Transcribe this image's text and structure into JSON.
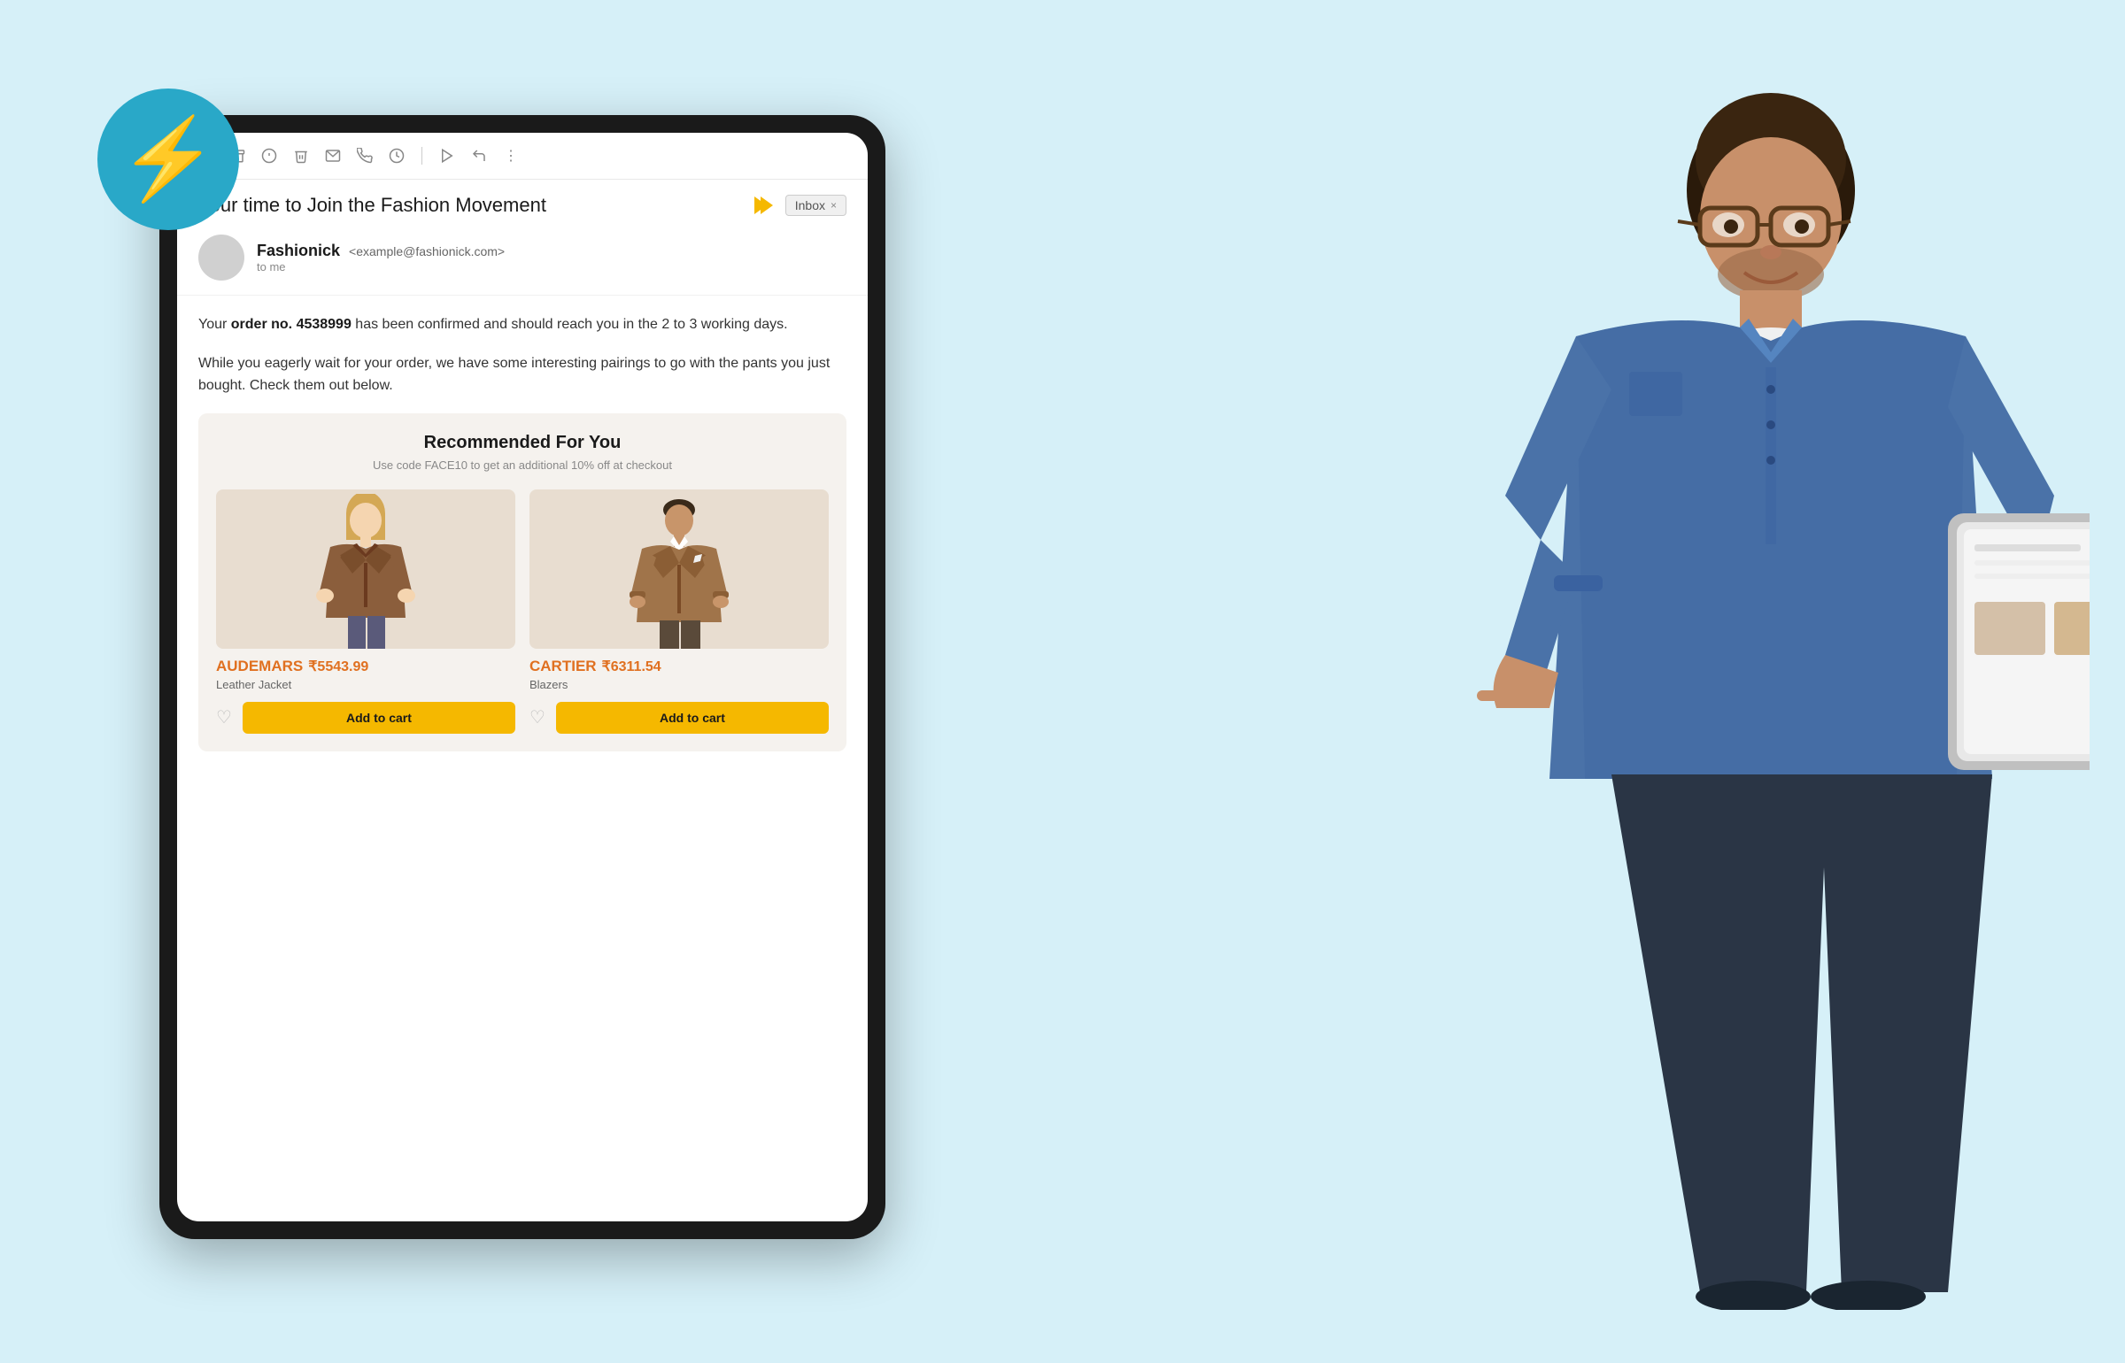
{
  "page": {
    "background_color": "#d6f0f8",
    "title": "Fashion Email UI"
  },
  "lightning": {
    "icon": "⚡",
    "bg_color": "#29a8c8"
  },
  "toolbar": {
    "icons": [
      "←",
      "☐",
      "?",
      "🗑",
      "✉",
      "☎",
      "◗",
      "|",
      "▶",
      "◀",
      "⋮"
    ]
  },
  "email": {
    "subject": "Your time to Join the Fashion Movement",
    "inbox_label": "Inbox",
    "inbox_close": "×",
    "sender_name": "Fashionick",
    "sender_email": "<example@fashionick.com>",
    "sender_to": "to me",
    "body_paragraph1_pre": "Your ",
    "body_order_no": "order no. 4538999",
    "body_paragraph1_post": " has been confirmed and should reach you in the 2 to 3 working days.",
    "body_paragraph2": "While you eagerly wait for your order, we have some interesting pairings to go with the pants you just bought. Check them out below.",
    "recommended": {
      "title": "Recommended For You",
      "subtitle": "Use code FACE10 to get an additional 10% off at checkout",
      "products": [
        {
          "id": "prod1",
          "brand": "AUDEMARS",
          "price": "₹5543.99",
          "name": "Leather Jacket",
          "cart_label": "Add to cart"
        },
        {
          "id": "prod2",
          "brand": "CARTIER",
          "price": "₹6311.54",
          "name": "Blazers",
          "cart_label": "Add to cart"
        }
      ]
    }
  }
}
